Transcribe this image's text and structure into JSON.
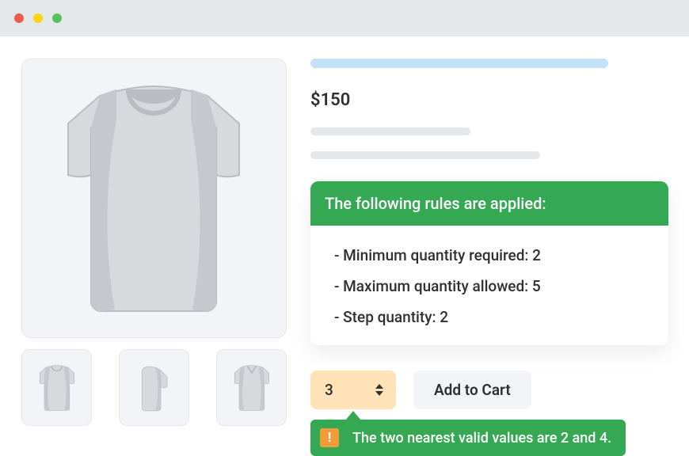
{
  "price": "$150",
  "rules": {
    "header": "The following rules are applied:",
    "min": "- Minimum quantity required: 2",
    "max": "- Maximum quantity allowed: 5",
    "step": "- Step quantity: 2"
  },
  "quantity_value": "3",
  "add_to_cart_label": "Add to Cart",
  "tooltip": {
    "warn_symbol": "!",
    "message": "The two nearest valid values are 2 and 4."
  }
}
